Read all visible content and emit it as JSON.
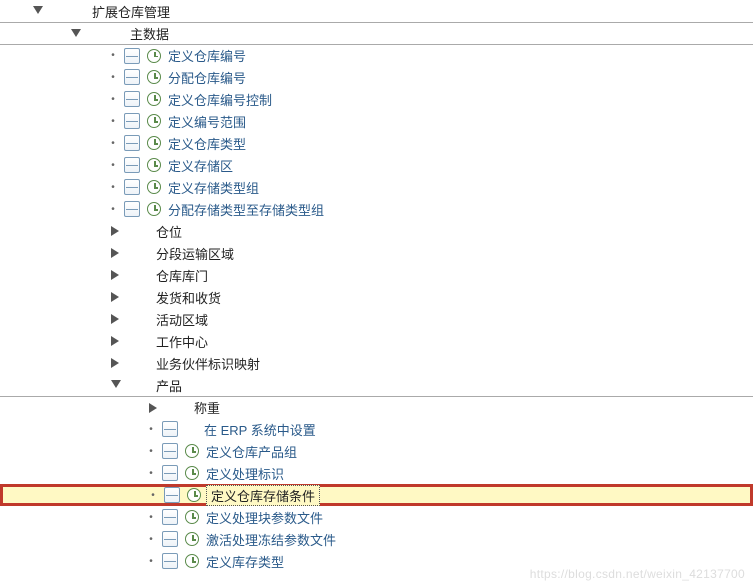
{
  "tree": {
    "root": {
      "label": "扩展仓库管理",
      "children": [
        {
          "label": "主数据",
          "expanded": true,
          "children": [
            {
              "label": "定义仓库编号",
              "doc": true,
              "exec": true,
              "leaf": true
            },
            {
              "label": "分配仓库编号",
              "doc": true,
              "exec": true,
              "leaf": true
            },
            {
              "label": "定义仓库编号控制",
              "doc": true,
              "exec": true,
              "leaf": true
            },
            {
              "label": "定义编号范围",
              "doc": true,
              "exec": true,
              "leaf": true
            },
            {
              "label": "定义仓库类型",
              "doc": true,
              "exec": true,
              "leaf": true
            },
            {
              "label": "定义存储区",
              "doc": true,
              "exec": true,
              "leaf": true
            },
            {
              "label": "定义存储类型组",
              "doc": true,
              "exec": true,
              "leaf": true
            },
            {
              "label": "分配存储类型至存储类型组",
              "doc": true,
              "exec": true,
              "leaf": true
            },
            {
              "label": "仓位",
              "leaf": false
            },
            {
              "label": "分段运输区域",
              "leaf": false
            },
            {
              "label": "仓库库门",
              "leaf": false
            },
            {
              "label": "发货和收货",
              "leaf": false
            },
            {
              "label": "活动区域",
              "leaf": false
            },
            {
              "label": "工作中心",
              "leaf": false
            },
            {
              "label": "业务伙伴标识映射",
              "leaf": false
            },
            {
              "label": "产品",
              "expanded": true,
              "children": [
                {
                  "label": "称重",
                  "leaf": false
                },
                {
                  "label": "在 ERP 系统中设置",
                  "doc": true,
                  "leaf": true
                },
                {
                  "label": "定义仓库产品组",
                  "doc": true,
                  "exec": true,
                  "leaf": true
                },
                {
                  "label": "定义处理标识",
                  "doc": true,
                  "exec": true,
                  "leaf": true
                },
                {
                  "label": "定义仓库存储条件",
                  "doc": true,
                  "exec": true,
                  "leaf": true,
                  "highlight": true
                },
                {
                  "label": "定义处理块参数文件",
                  "doc": true,
                  "exec": true,
                  "leaf": true
                },
                {
                  "label": "激活处理冻结参数文件",
                  "doc": true,
                  "exec": true,
                  "leaf": true
                },
                {
                  "label": "定义库存类型",
                  "doc": true,
                  "exec": true,
                  "leaf": true
                }
              ]
            }
          ]
        }
      ]
    }
  },
  "watermark": "https://blog.csdn.net/weixin_42137700"
}
